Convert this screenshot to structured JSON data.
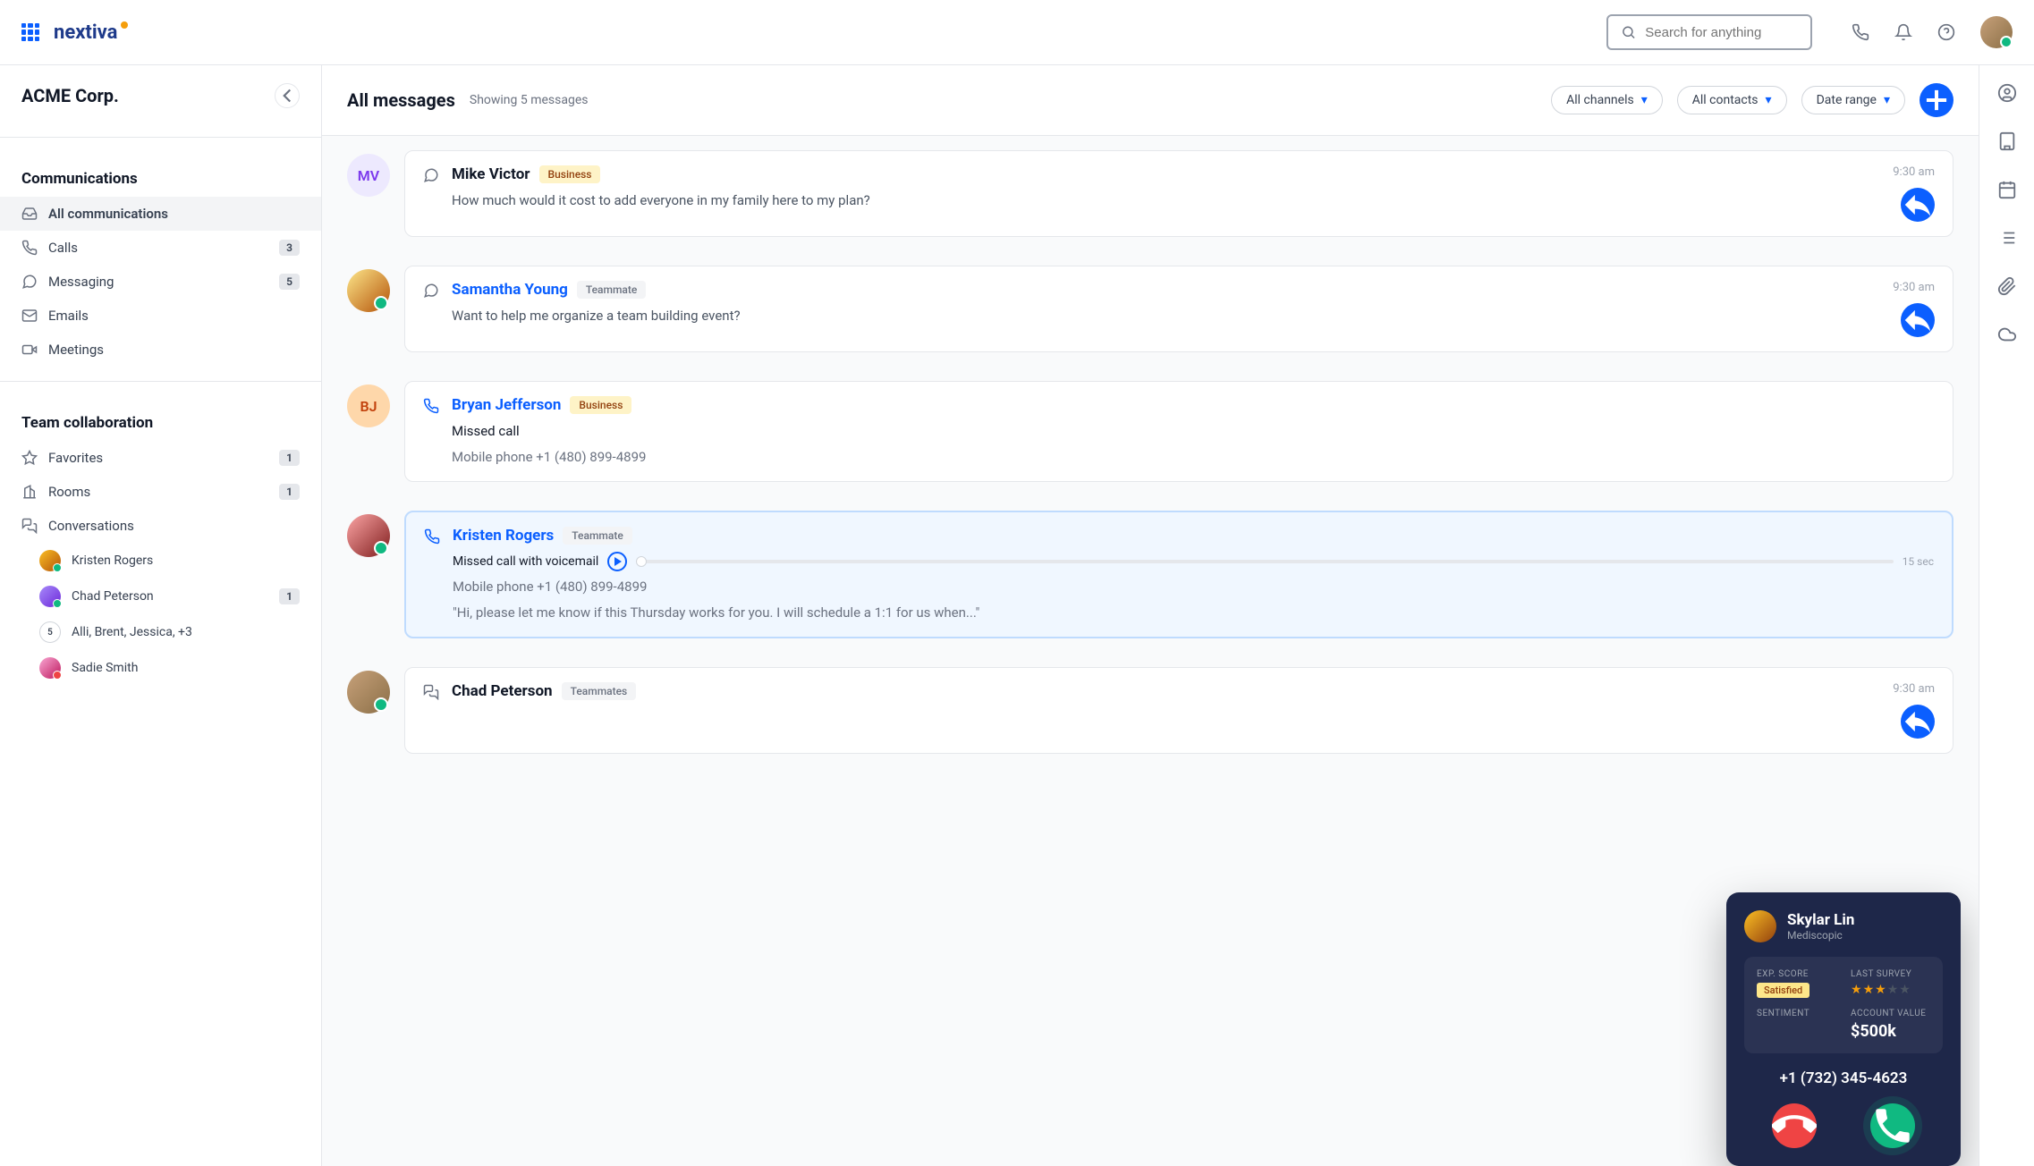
{
  "brand": "nextiva",
  "search": {
    "placeholder": "Search for anything"
  },
  "org": {
    "name": "ACME Corp."
  },
  "sidebar": {
    "section1_title": "Communications",
    "section2_title": "Team collaboration",
    "items": [
      {
        "label": "All communications",
        "badge": ""
      },
      {
        "label": "Calls",
        "badge": "3"
      },
      {
        "label": "Messaging",
        "badge": "5"
      },
      {
        "label": "Emails",
        "badge": ""
      },
      {
        "label": "Meetings",
        "badge": ""
      }
    ],
    "collab": [
      {
        "label": "Favorites",
        "badge": "1"
      },
      {
        "label": "Rooms",
        "badge": "1"
      },
      {
        "label": "Conversations",
        "badge": ""
      }
    ],
    "conversations": [
      {
        "name": "Kristen Rogers",
        "badge": ""
      },
      {
        "name": "Chad Peterson",
        "badge": "1"
      },
      {
        "name": "Alli, Brent, Jessica, +3",
        "badge": ""
      },
      {
        "name": "Sadie Smith",
        "badge": ""
      }
    ]
  },
  "main": {
    "title": "All messages",
    "subtitle": "Showing 5 messages",
    "filters": {
      "channels": "All channels",
      "contacts": "All contacts",
      "date": "Date range"
    }
  },
  "messages": [
    {
      "initials": "MV",
      "name": "Mike Victor",
      "tag": "Business",
      "body": "How much would it cost to add everyone in my family here to my plan?",
      "time": "9:30 am"
    },
    {
      "name": "Samantha Young",
      "tag": "Teammate",
      "body": "Want to help me organize a team building event?",
      "time": "9:30 am"
    },
    {
      "initials": "BJ",
      "name": "Bryan Jefferson",
      "tag": "Business",
      "status": "Missed call",
      "phone": "Mobile phone +1 (480) 899-4899"
    },
    {
      "name": "Kristen Rogers",
      "tag": "Teammate",
      "status": "Missed call with voicemail",
      "duration": "15 sec",
      "phone": "Mobile phone +1 (480) 899-4899",
      "transcript": "\"Hi, please let me know if this Thursday works for you. I will schedule a 1:1 for us when...\""
    },
    {
      "name": "Chad Peterson",
      "tag": "Teammates",
      "time": "9:30 am"
    }
  ],
  "call": {
    "name": "Skylar Lin",
    "company": "Mediscopic",
    "stats": {
      "exp_label": "EXP. SCORE",
      "exp_value": "Satisfied",
      "survey_label": "LAST SURVEY",
      "survey_stars": 3,
      "sentiment_label": "SENTIMENT",
      "account_label": "ACCOUNT VALUE",
      "account_value": "$500k"
    },
    "phone": "+1 (732) 345-4623"
  },
  "group_count": "5"
}
